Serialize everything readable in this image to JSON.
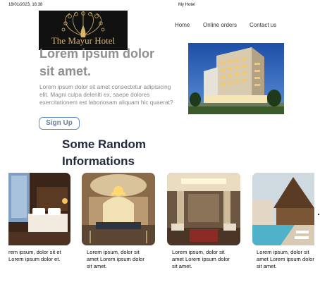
{
  "print_header": {
    "datetime": "18/01/2023, 16:38",
    "title": "My Hotel"
  },
  "logo": {
    "text": "The Mayur Hotel"
  },
  "nav": {
    "items": [
      "Home",
      "Online orders",
      "Contact us"
    ]
  },
  "hero": {
    "title": "Lorem ipsum dolor sit amet.",
    "text": "Lorem ipsum dolor sit amet consectetur adipisicing elit. Magni culpa deleniti ex, saepe dolores exercitationem est laboriosam aliquam hic quaerat?",
    "signup_label": "Sign Up"
  },
  "section": {
    "title": "Some Random Informations"
  },
  "cards": [
    {
      "text": "rem ipsum, dolor sit et Lorem ipsum dolor et."
    },
    {
      "text": "Lorem ipsum, dolor sit amet Lorem ipsum dolor sit amet."
    },
    {
      "text": "Lorem ipsum, dolor sit amet Lorem ipsum dolor sit amet."
    },
    {
      "text": "Lorem ipsum, dolor sit amet Lorem ipsum dolor sit amet."
    }
  ],
  "colors": {
    "logo_bg": "#111111",
    "logo_gold": "#d7b56b",
    "signup_border": "#5e8dc9",
    "section_title": "#222a3d",
    "hero_title": "#8f8f8f"
  }
}
